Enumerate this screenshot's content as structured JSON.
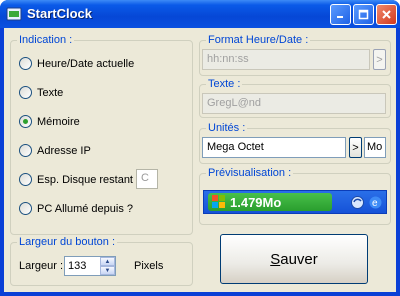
{
  "window": {
    "title": "StartClock"
  },
  "indication": {
    "label": "Indication :",
    "options": [
      {
        "label": "Heure/Date actuelle",
        "checked": false
      },
      {
        "label": "Texte",
        "checked": false
      },
      {
        "label": "Mémoire",
        "checked": true
      },
      {
        "label": "Adresse IP",
        "checked": false
      },
      {
        "label": "Esp. Disque restant",
        "checked": false
      },
      {
        "label": "PC Allumé depuis ?",
        "checked": false
      }
    ],
    "disk_value": "C"
  },
  "format": {
    "label": "Format Heure/Date :",
    "value": "hh:nn:ss",
    "button": ">"
  },
  "texte": {
    "label": "Texte :",
    "value": "GregL@nd"
  },
  "unites": {
    "label": "Unités :",
    "value": "Mega Octet",
    "button": ">",
    "unit": "Mo"
  },
  "preview": {
    "label": "Prévisualisation :",
    "value": "1.479Mo"
  },
  "button_width": {
    "label": "Largeur du bouton :",
    "field_label": "Largeur :",
    "value": "133",
    "unit": "Pixels"
  },
  "save": {
    "label_first": "S",
    "label_rest": "auver"
  }
}
